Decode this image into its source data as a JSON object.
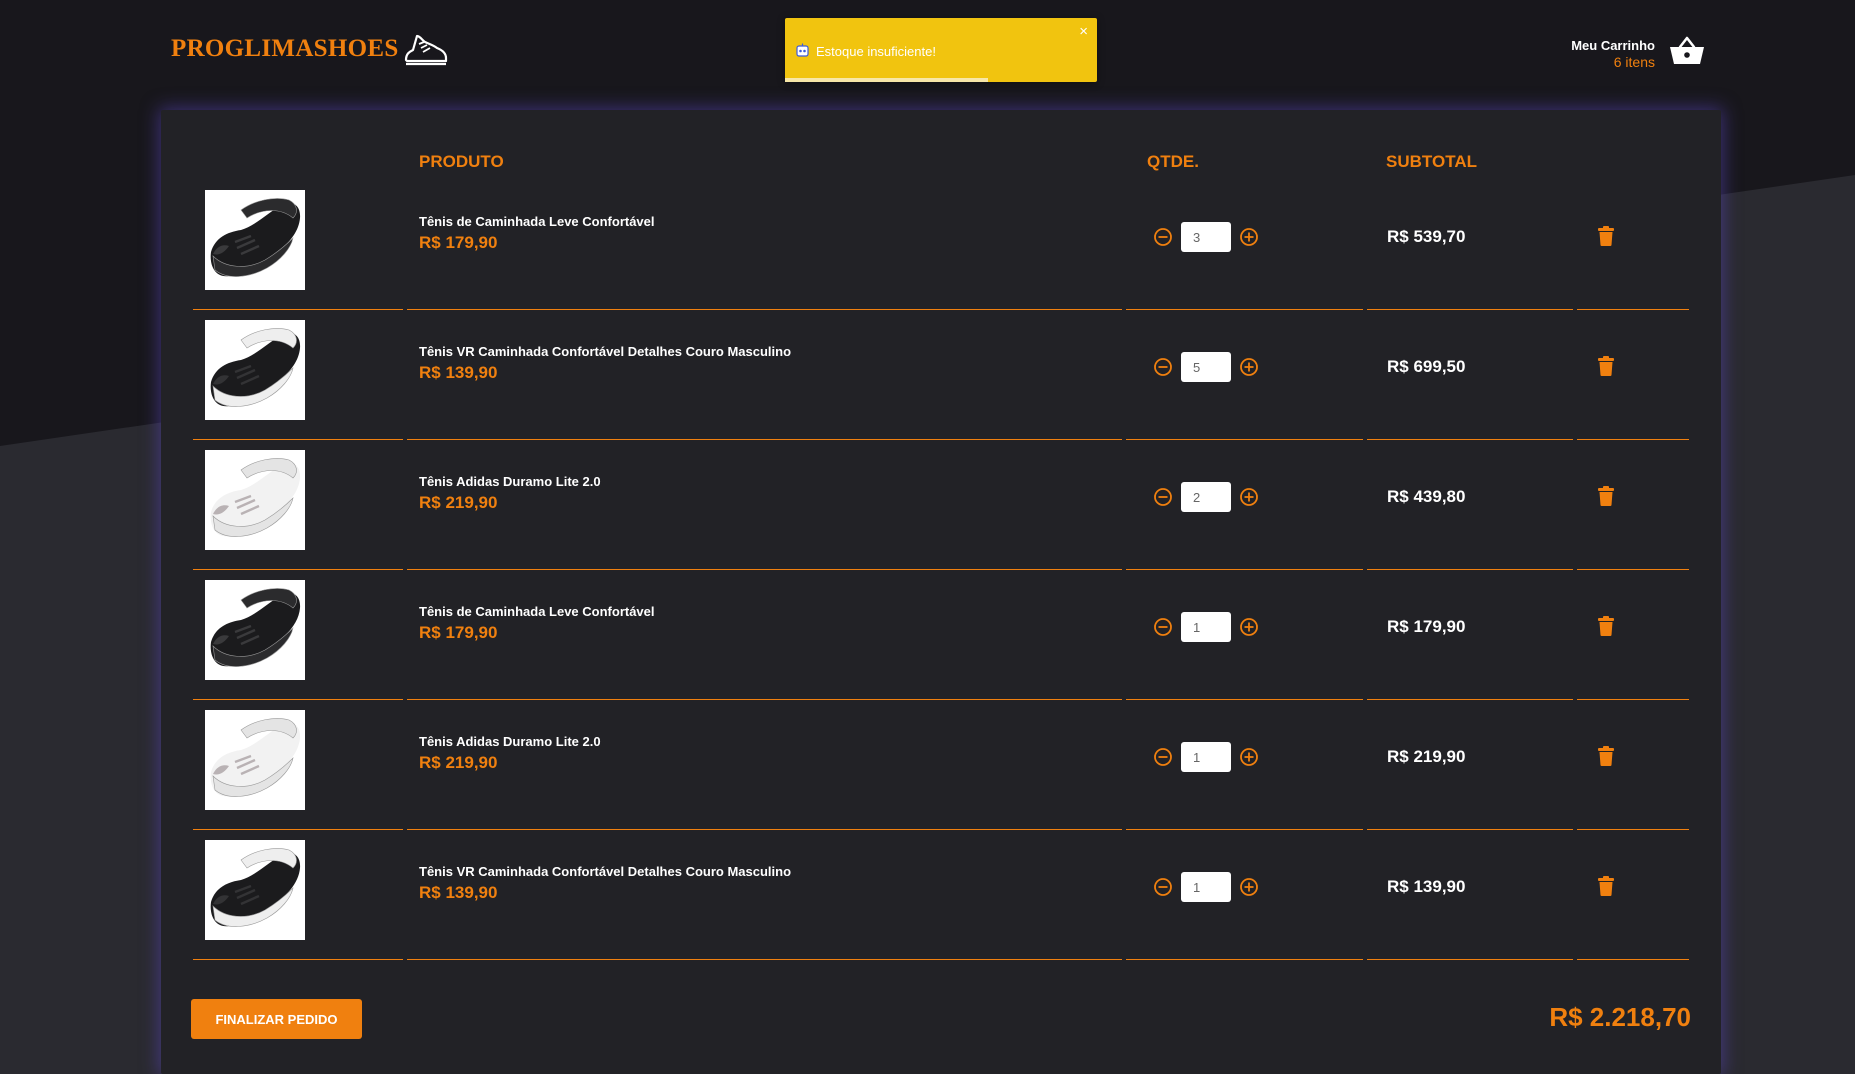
{
  "brand": {
    "name": "PROGLIMASHOES",
    "accent": "#f0800f"
  },
  "cart_header": {
    "title": "Meu Carrinho",
    "count": "6 itens"
  },
  "toast": {
    "message": "Estoque insuficiente!",
    "close": "×",
    "progress": 0.65,
    "color": "#f1c40f"
  },
  "table": {
    "headers": {
      "product": "PRODUTO",
      "quantity": "QTDE.",
      "subtotal": "SUBTOTAL"
    },
    "rows": [
      {
        "name": "Tênis de Caminhada Leve Confortável",
        "price": "R$ 179,90",
        "qty": "3",
        "subtotal": "R$ 539,70",
        "image": "black-sneaker"
      },
      {
        "name": "Tênis VR Caminhada Confortável Detalhes Couro Masculino",
        "price": "R$ 139,90",
        "qty": "5",
        "subtotal": "R$ 699,50",
        "image": "black-sneaker-white-sole"
      },
      {
        "name": "Tênis Adidas Duramo Lite 2.0",
        "price": "R$ 219,90",
        "qty": "2",
        "subtotal": "R$ 439,80",
        "image": "white-sneaker"
      },
      {
        "name": "Tênis de Caminhada Leve Confortável",
        "price": "R$ 179,90",
        "qty": "1",
        "subtotal": "R$ 179,90",
        "image": "black-sneaker"
      },
      {
        "name": "Tênis Adidas Duramo Lite 2.0",
        "price": "R$ 219,90",
        "qty": "1",
        "subtotal": "R$ 219,90",
        "image": "white-sneaker"
      },
      {
        "name": "Tênis VR Caminhada Confortável Detalhes Couro Masculino",
        "price": "R$ 139,90",
        "qty": "1",
        "subtotal": "R$ 139,90",
        "image": "black-sneaker-white-sole"
      }
    ]
  },
  "footer": {
    "checkout_label": "FINALIZAR PEDIDO",
    "total": "R$ 2.218,70"
  },
  "icons": {
    "logo": "sneaker-icon",
    "cart": "basket-icon",
    "decrement": "minus-circle-icon",
    "increment": "plus-circle-icon",
    "remove": "trash-icon",
    "toast": "robot-icon"
  }
}
